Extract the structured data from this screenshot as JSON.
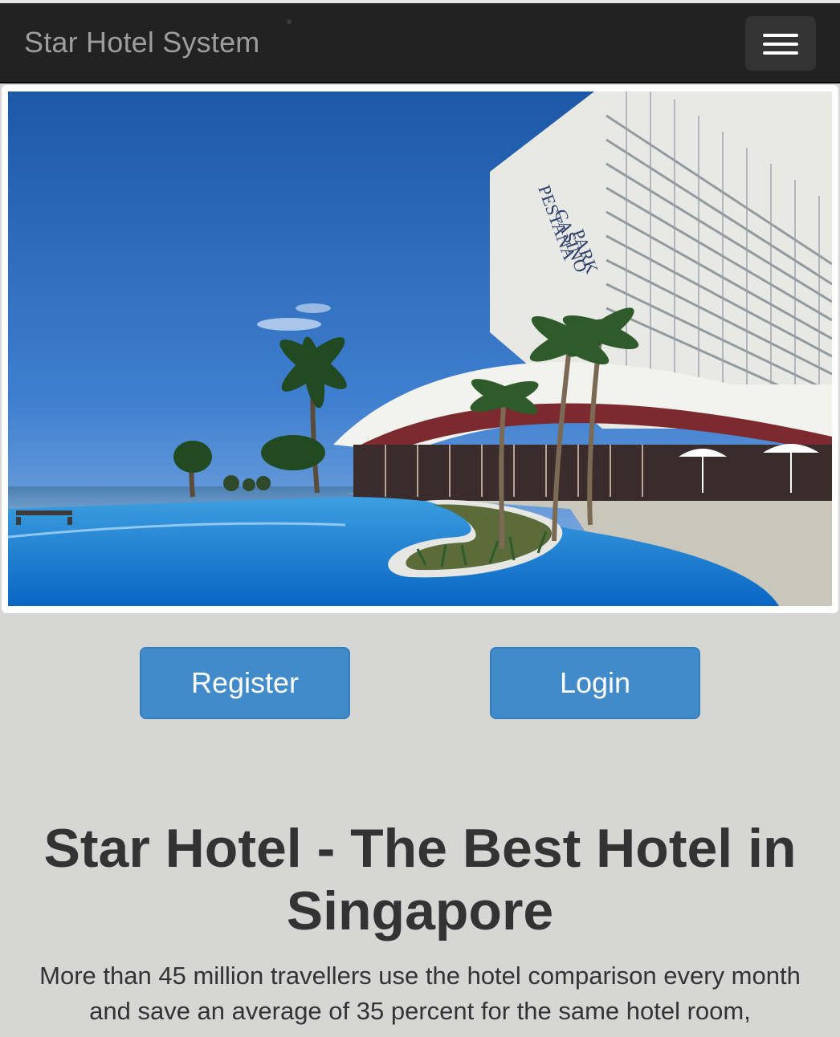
{
  "navbar": {
    "brand": "Star Hotel System",
    "menu_icon": "hamburger-menu-icon"
  },
  "hero": {
    "image_subject": "hotel with infinity pool and palm trees by the sea",
    "sign_text": [
      "PESTANA",
      "CASINO",
      "PARK"
    ]
  },
  "actions": {
    "register_label": "Register",
    "login_label": "Login"
  },
  "content": {
    "headline": "Star Hotel - The Best Hotel in Singapore",
    "lead": "More than 45 million travellers use the hotel comparison every month and save an average of 35 percent for the same hotel room,"
  },
  "colors": {
    "navbar_bg": "#222222",
    "brand_text": "#9d9d9d",
    "button_primary": "#428bca",
    "page_bg": "#d6d7d5",
    "text": "#333333"
  }
}
